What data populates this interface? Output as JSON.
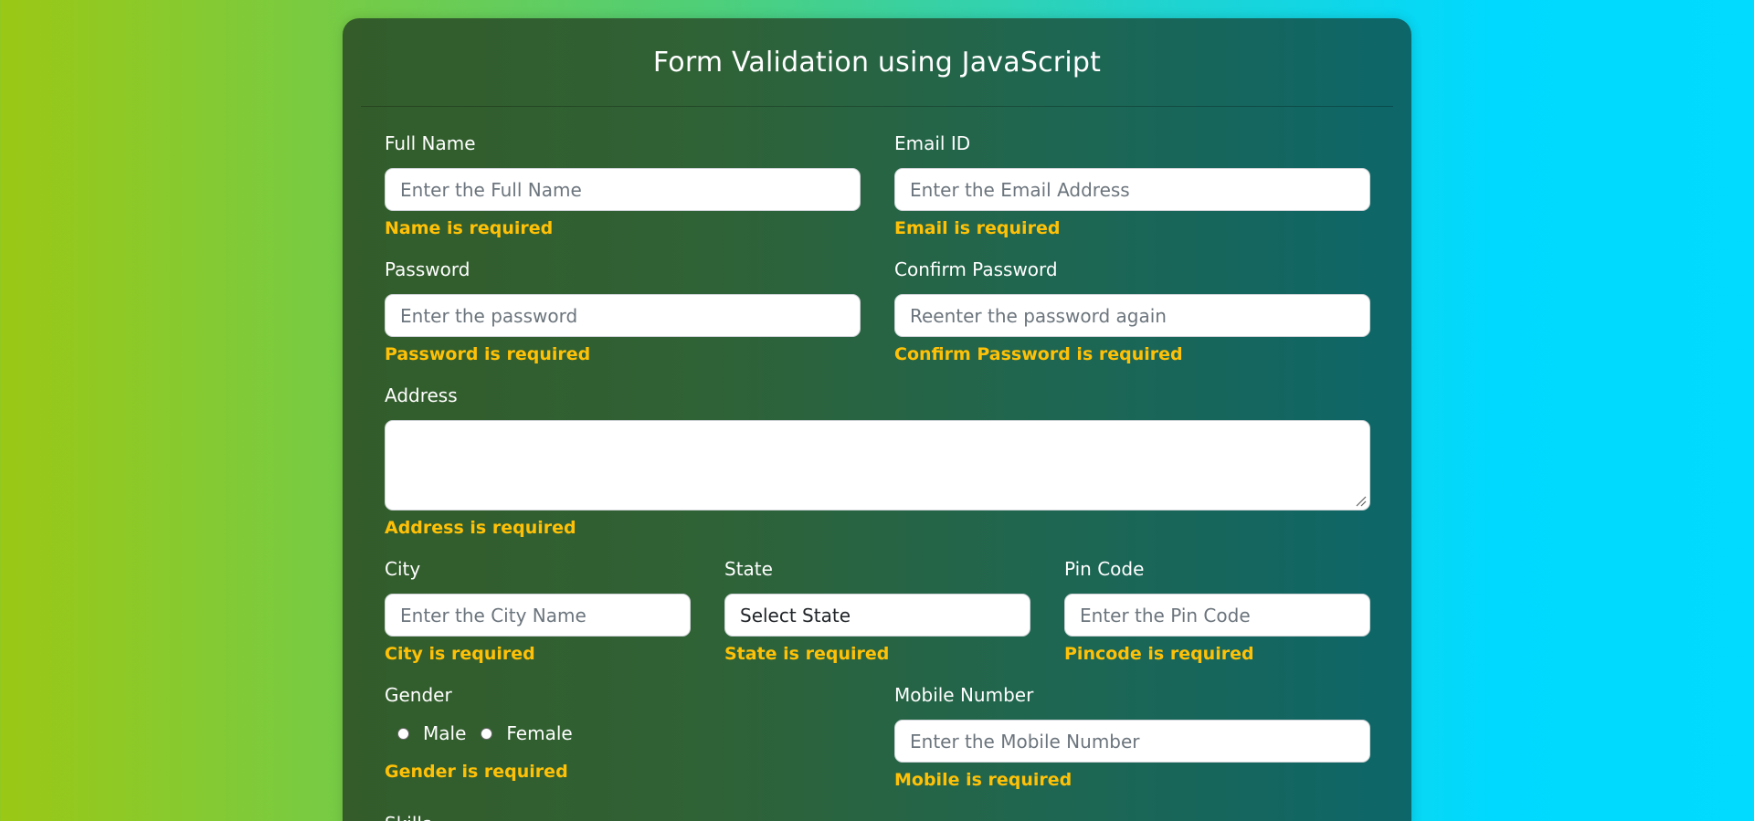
{
  "form": {
    "title": "Form Validation using JavaScript",
    "full_name": {
      "label": "Full Name",
      "placeholder": "Enter the Full Name",
      "error": "Name is required"
    },
    "email": {
      "label": "Email ID",
      "placeholder": "Enter the Email Address",
      "error": "Email is required"
    },
    "password": {
      "label": "Password",
      "placeholder": "Enter the password",
      "error": "Password is required"
    },
    "confirm_password": {
      "label": "Confirm Password",
      "placeholder": "Reenter the password again",
      "error": "Confirm Password is required"
    },
    "address": {
      "label": "Address",
      "value": "",
      "error": "Address is required"
    },
    "city": {
      "label": "City",
      "placeholder": "Enter the City Name",
      "error": "City is required"
    },
    "state": {
      "label": "State",
      "selected": "Select State",
      "error": "State is required"
    },
    "pincode": {
      "label": "Pin Code",
      "placeholder": "Enter the Pin Code",
      "error": "Pincode is required"
    },
    "gender": {
      "label": "Gender",
      "options": [
        "Male",
        "Female"
      ],
      "error": "Gender is required"
    },
    "mobile": {
      "label": "Mobile Number",
      "placeholder": "Enter the Mobile Number",
      "error": "Mobile is required"
    },
    "skills": {
      "label": "Skills"
    }
  },
  "colors": {
    "error": "#ffc107",
    "card_left": "#335c2a",
    "card_right": "#0d6669",
    "bg_left": "#9bc815",
    "bg_right": "#00dbff"
  }
}
